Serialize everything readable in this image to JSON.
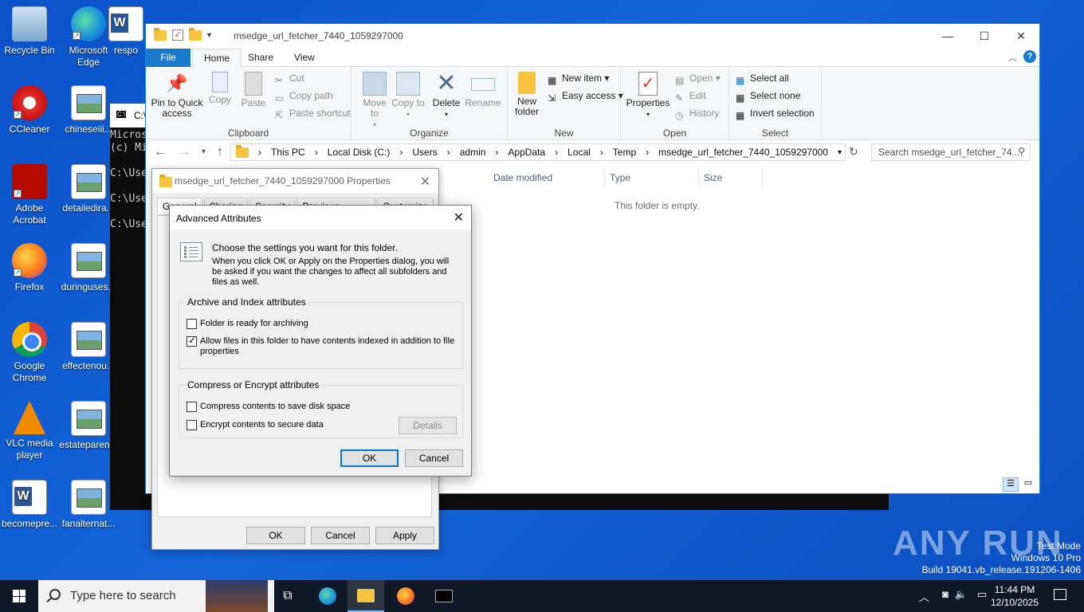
{
  "desktop": {
    "icons": [
      {
        "label": "Recycle Bin",
        "icon": "recycle-bin-icon"
      },
      {
        "label": "Microsoft Edge",
        "icon": "edge-icon"
      },
      {
        "label": "respo",
        "icon": "word-doc-icon"
      },
      {
        "label": "CCleaner",
        "icon": "ccleaner-icon"
      },
      {
        "label": "chineseiii...",
        "icon": "image-file-icon"
      },
      {
        "label": "Adobe Acrobat",
        "icon": "acrobat-icon"
      },
      {
        "label": "detailedira...",
        "icon": "image-file-icon"
      },
      {
        "label": "Firefox",
        "icon": "firefox-icon"
      },
      {
        "label": "duringuses...",
        "icon": "image-file-icon"
      },
      {
        "label": "Google Chrome",
        "icon": "chrome-icon"
      },
      {
        "label": "effectenou...",
        "icon": "image-file-icon"
      },
      {
        "label": "VLC media player",
        "icon": "vlc-icon"
      },
      {
        "label": "estateparen...",
        "icon": "image-file-icon"
      },
      {
        "label": "becomepre...",
        "icon": "word-doc-icon"
      },
      {
        "label": "fanalternat...",
        "icon": "image-file-icon"
      }
    ]
  },
  "console": {
    "title": "C:\\",
    "lines": [
      "Micros",
      "(c) Mi",
      "",
      "C:\\Use",
      "",
      "C:\\Use",
      "",
      "C:\\Use"
    ]
  },
  "explorer": {
    "title": "msedge_url_fetcher_7440_1059297000",
    "tabs": [
      "File",
      "Home",
      "Share",
      "View"
    ],
    "ribbon": {
      "clipboard": {
        "pin": "Pin to Quick access",
        "copy": "Copy",
        "paste": "Paste",
        "cut": "Cut",
        "copy_path": "Copy path",
        "paste_shortcut": "Paste shortcut",
        "label": "Clipboard"
      },
      "organize": {
        "move_to": "Move to",
        "copy_to": "Copy to",
        "delete": "Delete",
        "rename": "Rename",
        "label": "Organize"
      },
      "new": {
        "new_folder": "New folder",
        "new_item": "New item",
        "easy_access": "Easy access",
        "label": "New"
      },
      "open": {
        "properties": "Properties",
        "open": "Open",
        "edit": "Edit",
        "history": "History",
        "label": "Open"
      },
      "select": {
        "select_all": "Select all",
        "select_none": "Select none",
        "invert": "Invert selection",
        "label": "Select"
      }
    },
    "breadcrumb": [
      "This PC",
      "Local Disk (C:)",
      "Users",
      "admin",
      "AppData",
      "Local",
      "Temp",
      "msedge_url_fetcher_7440_1059297000"
    ],
    "search_placeholder": "Search msedge_url_fetcher_74...",
    "columns": [
      "Date modified",
      "Type",
      "Size"
    ],
    "empty_text": "This folder is empty."
  },
  "properties": {
    "title": "msedge_url_fetcher_7440_1059297000 Properties",
    "tabs": [
      "General",
      "Sharing",
      "Security",
      "Previous Versions",
      "Customize"
    ],
    "ok": "OK",
    "cancel": "Cancel",
    "apply": "Apply"
  },
  "advanced": {
    "title": "Advanced Attributes",
    "intro": "Choose the settings you want for this folder.",
    "note": "When you click OK or Apply on the Properties dialog, you will be asked if you want the changes to affect all subfolders and files as well.",
    "archive_group": "Archive and Index attributes",
    "archiving": {
      "label": "Folder is ready for archiving",
      "checked": false
    },
    "indexing": {
      "label": "Allow files in this folder to have contents indexed in addition to file properties",
      "checked": true
    },
    "compress_group": "Compress or Encrypt attributes",
    "compress": {
      "label": "Compress contents to save disk space",
      "checked": false
    },
    "encrypt": {
      "label": "Encrypt contents to secure data",
      "checked": false
    },
    "details": "Details",
    "ok": "OK",
    "cancel": "Cancel"
  },
  "taskbar": {
    "search_placeholder": "Type here to search",
    "time": "11:44 PM",
    "date": "12/10/2025"
  },
  "watermark": {
    "line1": "Test Mode",
    "line2": "Windows 10 Pro",
    "line3": "Build 19041.vb_release.191206-1406",
    "brand": "ANY RUN"
  }
}
